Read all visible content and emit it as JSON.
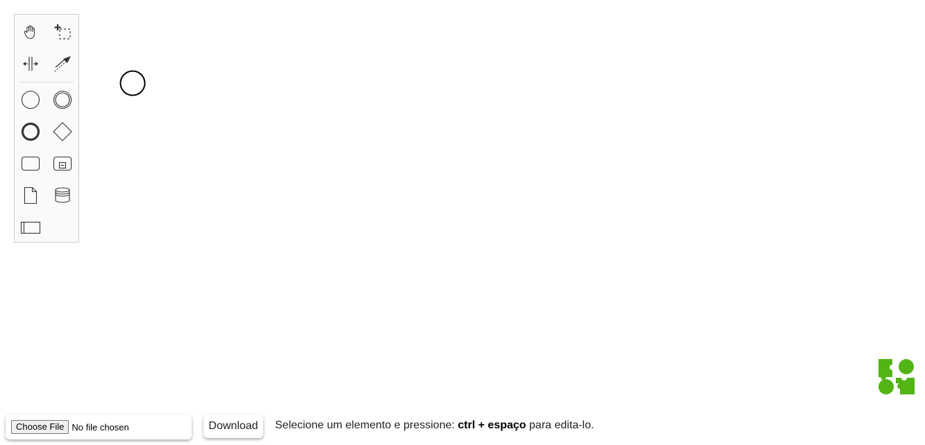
{
  "palette": {
    "tools": [
      {
        "name": "hand-tool",
        "icon": "hand-icon"
      },
      {
        "name": "lasso-tool",
        "icon": "lasso-icon"
      },
      {
        "name": "space-tool",
        "icon": "space-icon"
      },
      {
        "name": "global-connect-tool",
        "icon": "connect-icon"
      },
      {
        "name": "create-start-event",
        "icon": "start-event-icon"
      },
      {
        "name": "create-intermediate-event",
        "icon": "intermediate-event-icon"
      },
      {
        "name": "create-end-event",
        "icon": "end-event-icon"
      },
      {
        "name": "create-gateway",
        "icon": "gateway-icon"
      },
      {
        "name": "create-task",
        "icon": "task-icon"
      },
      {
        "name": "create-subprocess",
        "icon": "subprocess-icon"
      },
      {
        "name": "create-data-object",
        "icon": "data-object-icon"
      },
      {
        "name": "create-data-store",
        "icon": "data-store-icon"
      },
      {
        "name": "create-participant",
        "icon": "participant-icon"
      }
    ]
  },
  "canvas": {
    "elements": [
      {
        "type": "start-event"
      }
    ]
  },
  "logo": {
    "icon": "bpmn-io-logo-icon",
    "color": "#52b415"
  },
  "toolbar": {
    "file_button_label": "Choose File",
    "file_status": "No file chosen",
    "download_label": "Download",
    "hint_prefix": "Selecione um elemento e pressione:",
    "hint_shortcut": "ctrl + espaço",
    "hint_suffix": "para edita-lo."
  }
}
